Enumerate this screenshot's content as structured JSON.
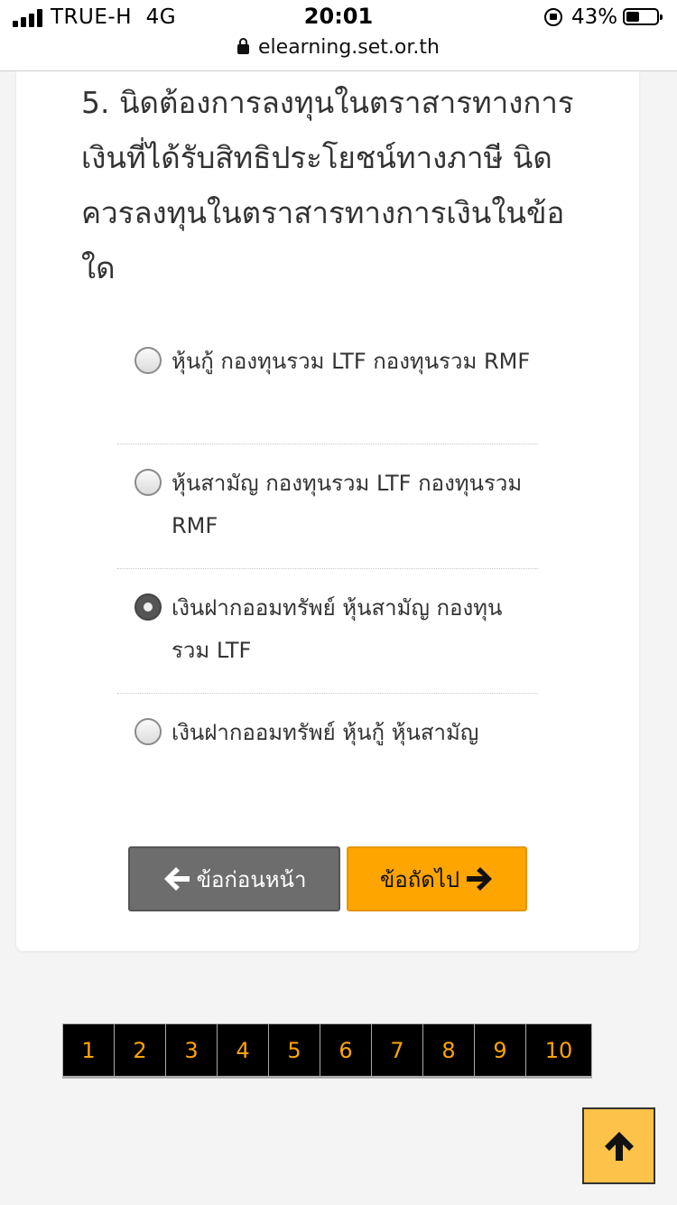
{
  "status_bar": {
    "carrier": "TRUE-H",
    "network": "4G",
    "time": "20:01",
    "battery": "43%",
    "url": "elearning.set.or.th"
  },
  "question": {
    "text": "5. นิดต้องการลงทุนในตราสารทางการเงินที่ได้รับสิทธิประโยชน์ทางภาษี นิดควรลงทุนในตราสารทางการเงินในข้อใด"
  },
  "options": [
    {
      "label": "หุ้นกู้ กองทุนรวม LTF กองทุนรวม RMF",
      "checked": false
    },
    {
      "label": "หุ้นสามัญ กองทุนรวม LTF กองทุนรวม RMF",
      "checked": false
    },
    {
      "label": "เงินฝากออมทรัพย์ หุ้นสามัญ กองทุนรวม LTF",
      "checked": true
    },
    {
      "label": "เงินฝากออมทรัพย์ หุ้นกู้ หุ้นสามัญ",
      "checked": false
    }
  ],
  "buttons": {
    "prev_label": "ข้อก่อนหน้า",
    "next_label": "ข้อถัดไป"
  },
  "pagination": [
    "1",
    "2",
    "3",
    "4",
    "5",
    "6",
    "7",
    "8",
    "9",
    "10"
  ],
  "colors": {
    "accent": "#ffa500",
    "prev_button": "#6d6d6d",
    "pager_bg": "#000000",
    "top_button": "#fdc24a"
  },
  "icons": {
    "prev": "arrow-left-icon",
    "next": "arrow-right-icon",
    "top": "arrow-up-icon",
    "lock": "lock-icon"
  }
}
